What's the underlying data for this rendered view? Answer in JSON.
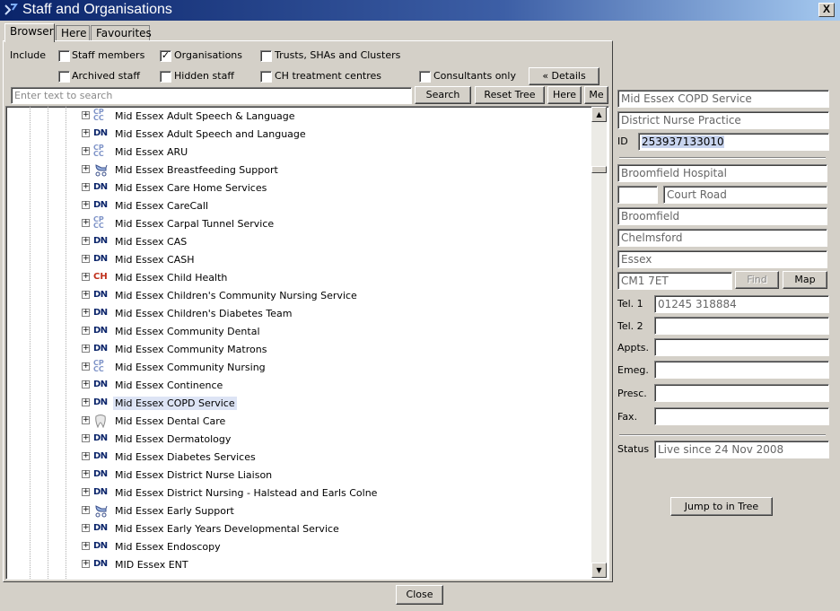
{
  "window": {
    "title": "Staff and Organisations",
    "close_label": "X"
  },
  "tabs": [
    {
      "label": "Browser",
      "active": true
    },
    {
      "label": "Here",
      "active": false
    },
    {
      "label": "Favourites",
      "active": false
    }
  ],
  "filters": {
    "include_label": "Include",
    "staff_members": {
      "label": "Staff members",
      "checked": false
    },
    "organisations": {
      "label": "Organisations",
      "checked": true,
      "mark": "✓"
    },
    "trusts": {
      "label": "Trusts, SHAs and Clusters",
      "checked": false
    },
    "archived_staff": {
      "label": "Archived staff",
      "checked": false
    },
    "hidden_staff": {
      "label": "Hidden staff",
      "checked": false
    },
    "ch_centres": {
      "label": "CH treatment centres",
      "checked": false
    },
    "consultants_only": {
      "label": "Consultants only",
      "checked": false
    },
    "details_button": "« Details"
  },
  "search": {
    "placeholder": "Enter text to search",
    "search_button": "Search",
    "reset_button": "Reset Tree",
    "here_button": "Here",
    "me_button": "Me"
  },
  "tree": {
    "items": [
      {
        "label": "Mid Essex Adult Speech & Language",
        "icon": "cpcc-icon",
        "badge": "CP CC"
      },
      {
        "label": "Mid Essex Adult Speech and Language",
        "icon": "dn-icon",
        "badge": "DN"
      },
      {
        "label": "Mid Essex ARU",
        "icon": "cpcc-icon",
        "badge": "CP CC"
      },
      {
        "label": "Mid Essex Breastfeeding Support",
        "icon": "pram-icon",
        "badge": ""
      },
      {
        "label": "Mid Essex Care Home Services",
        "icon": "dn-icon",
        "badge": "DN"
      },
      {
        "label": "Mid Essex CareCall",
        "icon": "dn-icon",
        "badge": "DN"
      },
      {
        "label": "Mid Essex Carpal Tunnel Service",
        "icon": "cpcc-icon",
        "badge": "CP CC"
      },
      {
        "label": "Mid Essex CAS",
        "icon": "dn-icon",
        "badge": "DN"
      },
      {
        "label": "Mid Essex CASH",
        "icon": "dn-icon",
        "badge": "DN"
      },
      {
        "label": "Mid Essex Child Health",
        "icon": "ch-icon",
        "badge": "CH"
      },
      {
        "label": "Mid Essex Children's Community Nursing Service",
        "icon": "dn-icon",
        "badge": "DN"
      },
      {
        "label": "Mid Essex Children's Diabetes Team",
        "icon": "dn-icon",
        "badge": "DN"
      },
      {
        "label": "Mid Essex Community Dental",
        "icon": "dn-icon",
        "badge": "DN"
      },
      {
        "label": "Mid Essex Community Matrons",
        "icon": "dn-icon",
        "badge": "DN"
      },
      {
        "label": "Mid Essex Community Nursing",
        "icon": "cpcc-icon",
        "badge": "CP CC"
      },
      {
        "label": "Mid Essex Continence",
        "icon": "dn-icon",
        "badge": "DN"
      },
      {
        "label": "Mid Essex COPD Service",
        "icon": "dn-icon",
        "badge": "DN",
        "selected": true
      },
      {
        "label": "Mid Essex Dental Care",
        "icon": "tooth-icon",
        "badge": ""
      },
      {
        "label": "Mid Essex Dermatology",
        "icon": "dn-icon",
        "badge": "DN"
      },
      {
        "label": "Mid Essex Diabetes Services",
        "icon": "dn-icon",
        "badge": "DN"
      },
      {
        "label": "Mid Essex District Nurse Liaison",
        "icon": "dn-icon",
        "badge": "DN"
      },
      {
        "label": "Mid Essex District Nursing - Halstead and Earls Colne",
        "icon": "dn-icon",
        "badge": "DN"
      },
      {
        "label": "Mid Essex Early Support",
        "icon": "pram-icon",
        "badge": ""
      },
      {
        "label": "Mid Essex Early Years Developmental Service",
        "icon": "dn-icon",
        "badge": "DN"
      },
      {
        "label": "Mid Essex Endoscopy",
        "icon": "dn-icon",
        "badge": "DN"
      },
      {
        "label": "MID Essex ENT",
        "icon": "dn-icon",
        "badge": "DN"
      }
    ]
  },
  "details": {
    "name": "Mid Essex COPD Service",
    "type": "District Nurse Practice",
    "id_label": "ID",
    "id_value": "253937133010",
    "address1": "Broomfield Hospital",
    "address_number": "",
    "address_street": "Court Road",
    "town": "Broomfield",
    "city": "Chelmsford",
    "county": "Essex",
    "postcode": "CM1 7ET",
    "find_button": "Find",
    "map_button": "Map",
    "tel1_label": "Tel. 1",
    "tel1_value": "01245 318884",
    "tel2_label": "Tel. 2",
    "tel2_value": "",
    "appts_label": "Appts.",
    "appts_value": "",
    "emeg_label": "Emeg.",
    "emeg_value": "",
    "presc_label": "Presc.",
    "presc_value": "",
    "fax_label": "Fax.",
    "fax_value": "",
    "status_label": "Status",
    "status_value": "Live since 24 Nov 2008",
    "jump_button": "Jump to in Tree"
  },
  "footer": {
    "close_button": "Close"
  },
  "colors": {
    "title_gradient_start": "#0a246a",
    "selection_bg": "#dde4f5",
    "dn_badge": "#0a246a",
    "ch_badge": "#c0301c",
    "cpcc_badge": "#7f94c8"
  }
}
